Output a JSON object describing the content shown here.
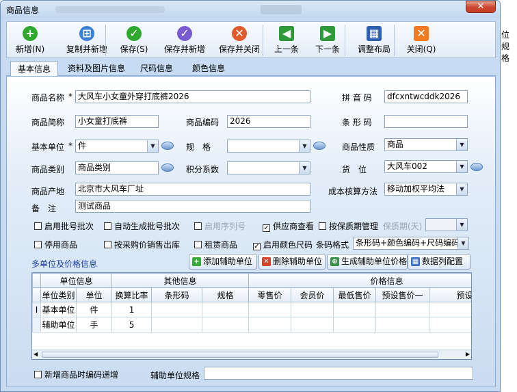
{
  "window": {
    "title": "商品信息",
    "close_glyph": "✕",
    "extra_right_text": "位规格"
  },
  "toolbar": [
    {
      "label": "新增(N)",
      "icon": "plus-icon",
      "color": "#2fa82f",
      "glyph": "+"
    },
    {
      "label": "复制并新增",
      "icon": "copy-icon",
      "color": "#3a7fd6",
      "glyph": "⊞"
    },
    {
      "label": "保存(S)",
      "icon": "check-icon",
      "color": "#2fa82f",
      "glyph": "✓"
    },
    {
      "label": "保存并新增",
      "icon": "check-icon",
      "color": "#7a5ad0",
      "glyph": "✓"
    },
    {
      "label": "保存并关闭",
      "icon": "x-icon",
      "color": "#e05a2a",
      "glyph": "✕"
    },
    {
      "label": "上一条",
      "icon": "prev-icon",
      "color": "#2f9a3a",
      "glyph": "◀"
    },
    {
      "label": "下一条",
      "icon": "next-icon",
      "color": "#2f9a3a",
      "glyph": "▶"
    },
    {
      "label": "调整布局",
      "icon": "layout-icon",
      "color": "#2f5fb0",
      "glyph": "▦"
    },
    {
      "label": "关闭(Q)",
      "icon": "close-icon",
      "color": "#f07b22",
      "glyph": "✕"
    }
  ],
  "tabs": [
    "基本信息",
    "资料及图片信息",
    "尺码信息",
    "颜色信息"
  ],
  "form": {
    "name_label": "商品名称",
    "name_value": "大风车小女童外穿打底裤2026",
    "pinyin_label": "拼 音 码",
    "pinyin_value": "dfcxntwcddk2026",
    "short_label": "商品简称",
    "short_value": "小女童打底裤",
    "code_label": "商品编码",
    "code_value": "2026",
    "barcode_label": "条 形 码",
    "barcode_value": "",
    "unit_label": "基本单位",
    "unit_value": "件",
    "spec_label": "规　格",
    "spec_value": "",
    "nature_label": "商品性质",
    "nature_value": "商品",
    "category_label": "商品类别",
    "category_value": "商品类别",
    "points_label": "积分系数",
    "points_value": "",
    "shelf_label": "货　位",
    "shelf_value": "大风车002",
    "origin_label": "商品产地",
    "origin_value": "北京市大风车厂址",
    "cost_label": "成本核算方法",
    "cost_value": "移动加权平均法",
    "remark_label": "备　注",
    "remark_value": "测试商品",
    "required_mark": "*"
  },
  "checks": [
    {
      "label": "启用批号批次",
      "checked": false
    },
    {
      "label": "自动生成批号批次",
      "checked": false
    },
    {
      "label": "启用序列号",
      "checked": false
    },
    {
      "label": "供应商查看",
      "checked": true
    },
    {
      "label": "按保质期管理",
      "checked": false
    },
    {
      "label": "停用商品",
      "checked": false
    },
    {
      "label": "按采购价销售出库",
      "checked": false
    },
    {
      "label": "租赁商品",
      "checked": false
    },
    {
      "label": "启用颜色尺码",
      "checked": true
    }
  ],
  "shelf_life": {
    "label": "保质期(天)",
    "value": ""
  },
  "barcode_format": {
    "label": "条码格式",
    "value": "条形码+颜色编码+尺码编码"
  },
  "multi_unit": {
    "title": "多单位及价格信息",
    "buttons": [
      "添加辅助单位",
      "删除辅助单位",
      "生成辅助单位价格",
      "数据列配置"
    ]
  },
  "grid": {
    "groups": [
      "单位信息",
      "其他信息",
      "价格信息"
    ],
    "headers": [
      "单位类别",
      "单位",
      "换算比率",
      "条形码",
      "规格",
      "零售价",
      "会员价",
      "最低售价",
      "预设售价一",
      "预设售价二"
    ],
    "rows": [
      {
        "marker": "I",
        "cells": [
          "基本单位",
          "件",
          "1",
          "",
          "",
          "",
          "",
          "",
          "",
          ""
        ]
      },
      {
        "marker": "",
        "cells": [
          "辅助单位",
          "手",
          "5",
          "",
          "",
          "",
          "",
          "",
          "",
          ""
        ]
      }
    ]
  },
  "footer": {
    "increment_label": "新增商品时编码递增",
    "aux_spec_label": "辅助单位规格",
    "aux_spec_value": ""
  }
}
